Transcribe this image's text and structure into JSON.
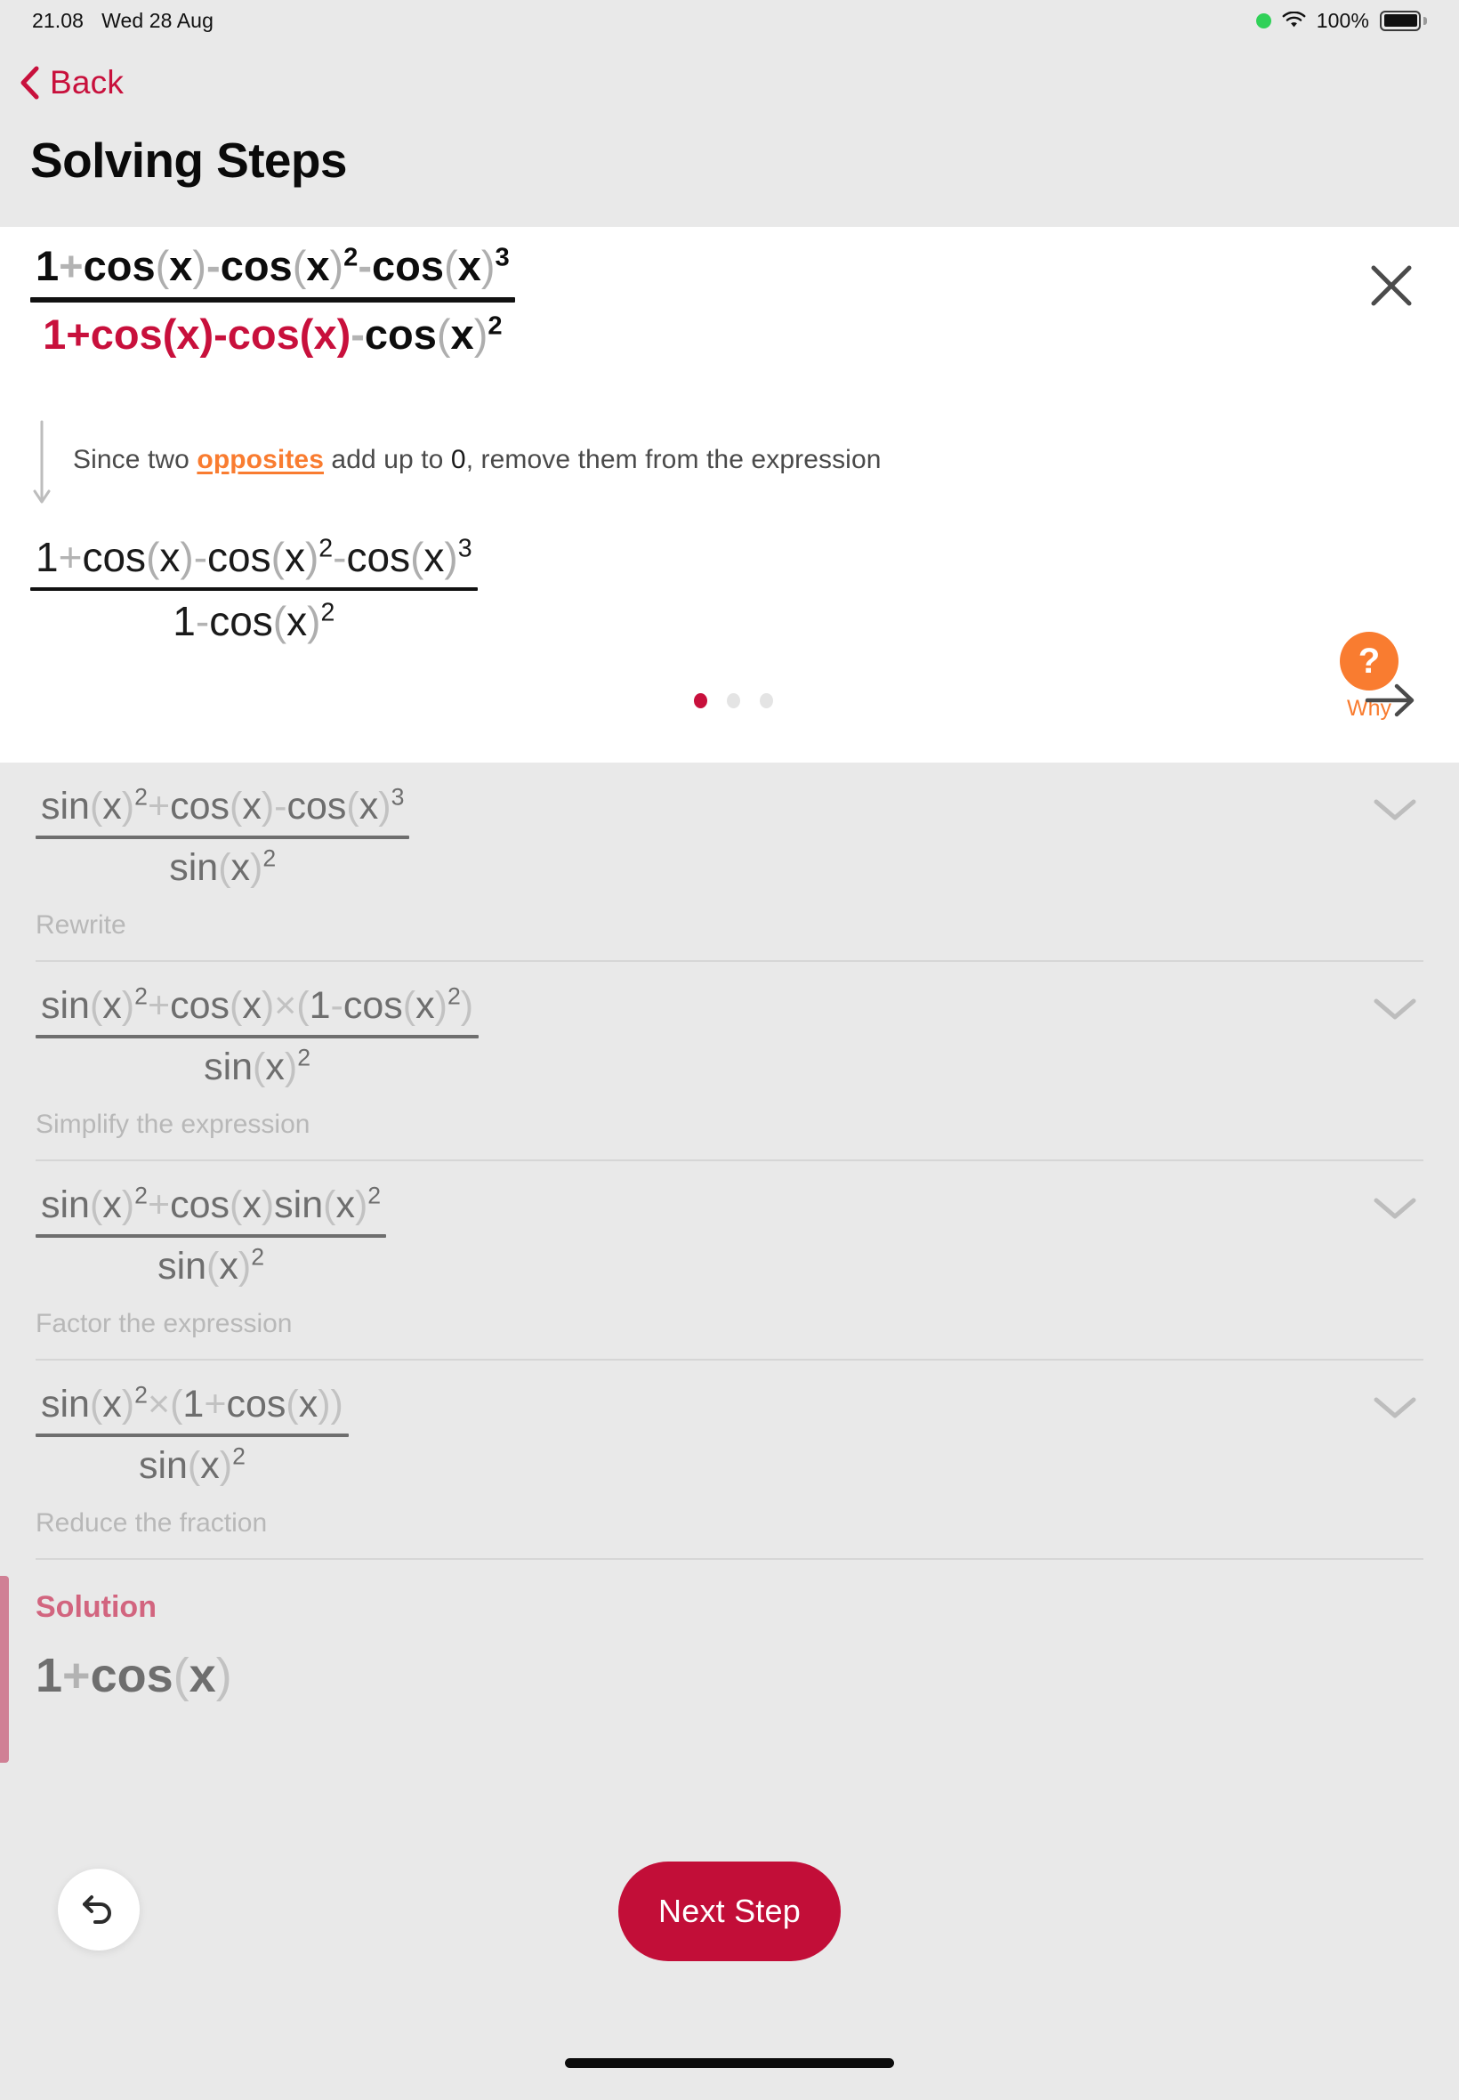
{
  "status_bar": {
    "time": "21.08",
    "date": "Wed 28 Aug",
    "battery_percent": "100%",
    "icons": [
      "green-dot-icon",
      "wifi-icon",
      "battery-icon"
    ]
  },
  "nav": {
    "back_label": "Back",
    "back_icon": "chevron-left-icon"
  },
  "page_title": "Solving Steps",
  "active_step": {
    "close_icon": "close-icon",
    "why_badge": "?",
    "why_label": "Why",
    "expression_before": {
      "numerator": "1 + cos(x) - cos(x)^2 - cos(x)^3",
      "denominator": "1 + cos(x) - cos(x) - cos(x)^2",
      "denominator_highlight": "1 + cos(x) - cos(x)"
    },
    "explanation": {
      "prefix": "Since two ",
      "highlight": "opposites",
      "middle": " add up to ",
      "zero": "0",
      "suffix": ", remove them from the expression"
    },
    "expression_after": {
      "numerator": "1 + cos(x) - cos(x)^2 - cos(x)^3",
      "denominator": "1 - cos(x)^2"
    },
    "pager": {
      "total_dots": 3,
      "active_index": 0,
      "next_icon": "arrow-right-icon"
    }
  },
  "steps": [
    {
      "numerator": "sin(x)^2 + cos(x) - cos(x)^3",
      "denominator": "sin(x)^2",
      "caption": "Rewrite",
      "chevron": "chevron-down-icon"
    },
    {
      "numerator": "sin(x)^2 + cos(x) x (1 - cos(x)^2)",
      "denominator": "sin(x)^2",
      "caption": "Simplify the expression",
      "chevron": "chevron-down-icon"
    },
    {
      "numerator": "sin(x)^2 + cos(x) sin(x)^2",
      "denominator": "sin(x)^2",
      "caption": "Factor the expression",
      "chevron": "chevron-down-icon"
    },
    {
      "numerator": "sin(x)^2 x (1 + cos(x))",
      "denominator": "sin(x)^2",
      "caption": "Reduce the fraction",
      "chevron": "chevron-down-icon"
    }
  ],
  "solution": {
    "title": "Solution",
    "expression": "1 + cos(x)"
  },
  "bottom": {
    "undo_icon": "undo-icon",
    "next_step_label": "Next Step"
  },
  "colors": {
    "accent_red": "#c20e38",
    "highlight_orange": "#f97c30",
    "solution_pink": "#d2657f",
    "page_background": "#e9e9e9",
    "card_background": "#ffffff"
  }
}
